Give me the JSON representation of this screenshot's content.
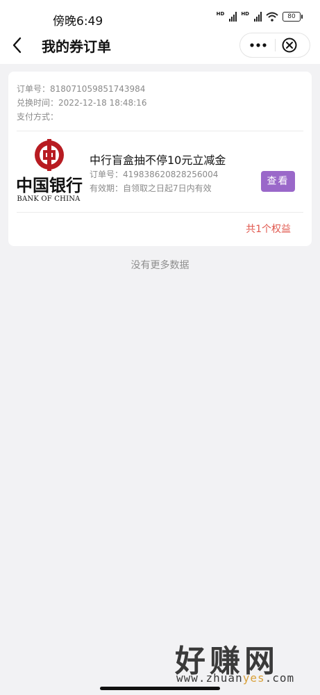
{
  "status": {
    "time": "傍晚6:49",
    "battery": "80",
    "hd1": "HD",
    "hd2": "HD"
  },
  "nav": {
    "title": "我的券订单"
  },
  "order": {
    "order_no": "订单号：818071059851743984",
    "exchange_time": "兑换时间：2022-12-18 18:48:16",
    "payment": "支付方式："
  },
  "logo": {
    "brand_cn": "中国银行",
    "brand_en": "BANK OF CHINA"
  },
  "coupon": {
    "title": "中行盲盒抽不停10元立减金",
    "order_no": "订单号：419838620828256004",
    "validity": "有效期：自领取之日起7日内有效",
    "view_label": "查看"
  },
  "summary": {
    "total": "共1个权益"
  },
  "list_end": "没有更多数据",
  "watermark": {
    "cn": "好赚网",
    "url_pre": "www.zhuan",
    "url_hl": "yes",
    "url_post": ".com"
  },
  "colors": {
    "accent_purple": "#9a68c9",
    "total_red": "#e0574d",
    "boc_red": "#b81c22"
  }
}
